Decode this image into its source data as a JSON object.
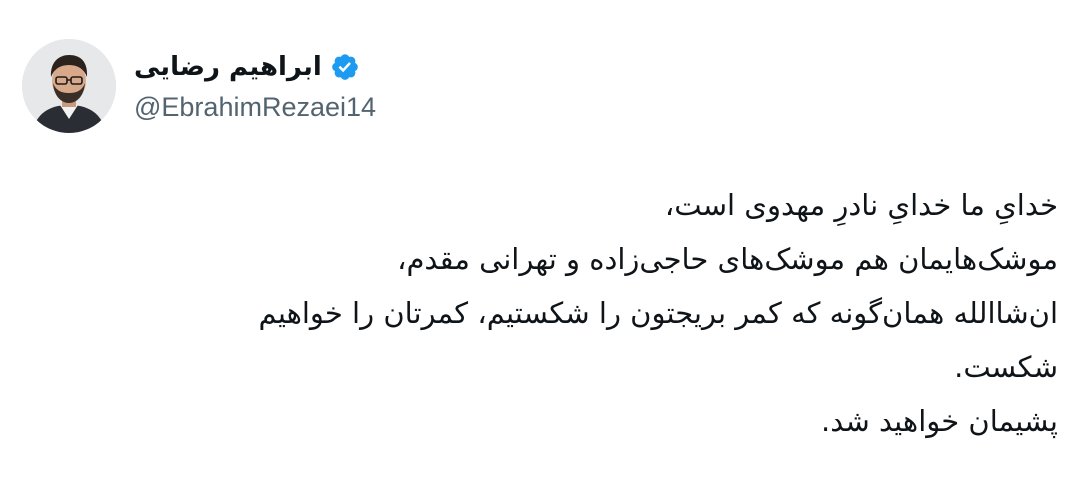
{
  "author": {
    "display_name": "ابراهیم رضایی",
    "handle": "@EbrahimRezaei14",
    "verified": true,
    "verified_icon": "verified-badge-icon",
    "accent_color": "#1d9bf0"
  },
  "tweet": {
    "lines": [
      "خدایِ ما خدایِ نادرِ مهدوی است،",
      "موشک‌هایمان هم موشک‌های حاجی‌زاده و تهرانی مقدم،",
      "ان‌شاالله همان‌گونه که کمر بریجتون را شکستیم، کمرتان را خواهیم",
      "شکست.",
      "پشیمان خواهید شد."
    ]
  }
}
